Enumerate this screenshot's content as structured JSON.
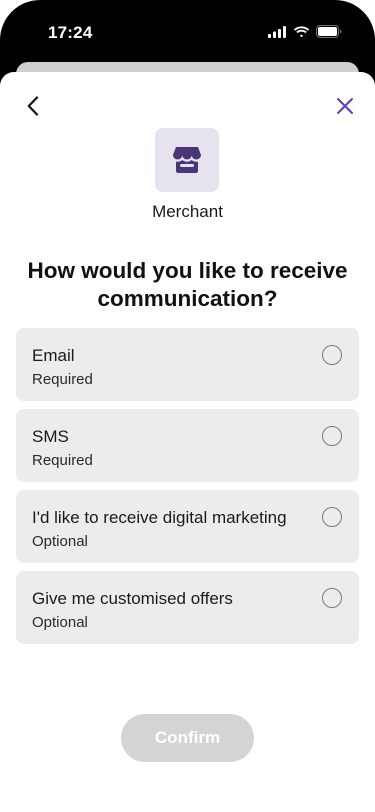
{
  "status_bar": {
    "time": "17:24"
  },
  "header": {
    "back_icon": "chevron-left-icon",
    "close_icon": "close-icon",
    "close_color": "#5b3db5"
  },
  "merchant": {
    "icon": "storefront-icon",
    "icon_color": "#4a3577",
    "label": "Merchant"
  },
  "question": {
    "title": "How would you like to receive communication?"
  },
  "options": [
    {
      "label": "Email",
      "sub": "Required",
      "selected": false
    },
    {
      "label": "SMS",
      "sub": "Required",
      "selected": false
    },
    {
      "label": "I'd like to receive digital marketing",
      "sub": "Optional",
      "selected": false
    },
    {
      "label": "Give me customised offers",
      "sub": "Optional",
      "selected": false
    }
  ],
  "confirm": {
    "label": "Confirm",
    "enabled": false
  }
}
